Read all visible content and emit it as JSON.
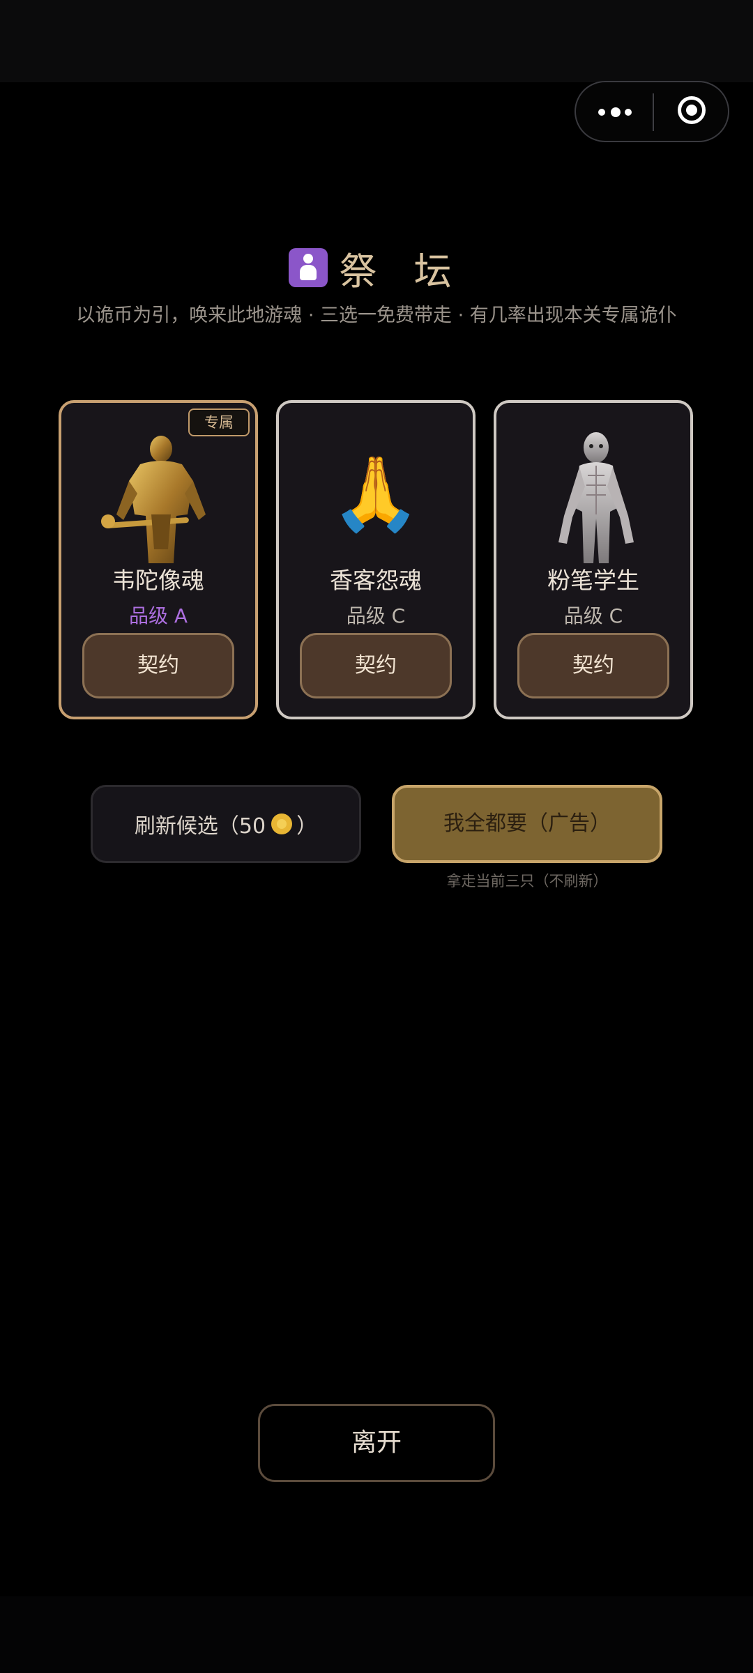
{
  "header": {
    "title": "祭 坛",
    "icon": "altar-icon",
    "subtitle": "以诡币为引，唤来此地游魂 · 三选一免费带走 · 有几率出现本关专属诡仆"
  },
  "cards": [
    {
      "name": "韦陀像魂",
      "grade": "品级 A",
      "badge": "专属",
      "button": "契约",
      "icon": "golden-armor-statue"
    },
    {
      "name": "香客怨魂",
      "grade": "品级 C",
      "button": "契约",
      "icon": "praying-hands",
      "emoji": "🙏"
    },
    {
      "name": "粉笔学生",
      "grade": "品级 C",
      "button": "契约",
      "icon": "pale-figure"
    }
  ],
  "actions": {
    "refresh_prefix": "刷新候选（50",
    "refresh_suffix": "）",
    "take_all": "我全都要（广告）",
    "take_all_note": "拿走当前三只（不刷新）"
  },
  "leave": "离开",
  "colors": {
    "background": "#000000",
    "title_gold": "#d9c3a0",
    "grade_a_purple": "#ad6fe0",
    "card_border": "#cfc9c3",
    "exclusive_border": "#c8a071",
    "contract_button": "#4d382a",
    "take_all_button": "#7d6431"
  }
}
